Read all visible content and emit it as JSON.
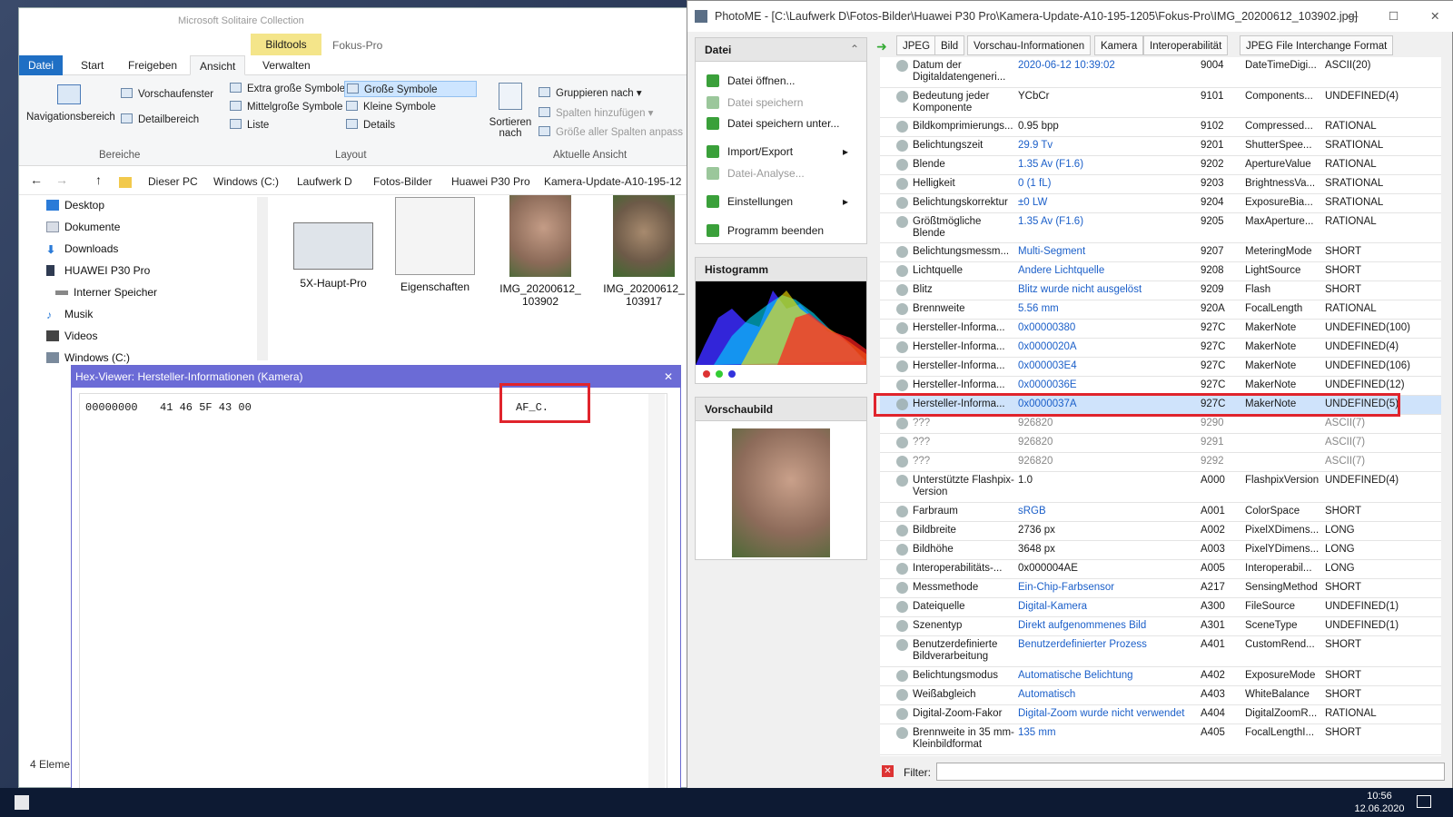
{
  "explorer": {
    "title_hint": "Microsoft Solitaire Collection",
    "ribbon_tabs": [
      "Datei",
      "Start",
      "Freigeben",
      "Ansicht",
      "Verwalten"
    ],
    "context_tab": "Bildtools",
    "context_title": "Fokus-Pro",
    "ribbon": {
      "nav_pane": "Navigationsbereich",
      "preview_pane": "Vorschaufenster",
      "details_pane": "Detailbereich",
      "group_panes": "Bereiche",
      "layout_items": [
        "Extra große Symbole",
        "Große Symbole",
        "Mittelgroße Symbole",
        "Kleine Symbole",
        "Liste",
        "Details"
      ],
      "group_layout": "Layout",
      "sort_label": "Sortieren nach",
      "group_by": "Gruppieren nach",
      "add_columns": "Spalten hinzufügen",
      "size_columns": "Größe aller Spalten anpass",
      "group_current": "Aktuelle Ansicht"
    },
    "breadcrumb": [
      "Dieser PC",
      "Windows (C:)",
      "Laufwerk D",
      "Fotos-Bilder",
      "Huawei P30 Pro",
      "Kamera-Update-A10-195-12"
    ],
    "nav_items": [
      "Desktop",
      "Dokumente",
      "Downloads",
      "HUAWEI P30 Pro",
      "Interner Speicher",
      "Musik",
      "Videos",
      "Windows (C:)"
    ],
    "thumbs": [
      "5X-Haupt-Pro",
      "Eigenschaften",
      "IMG_20200612_103902",
      "IMG_20200612_103917"
    ],
    "status": "4 Eleme"
  },
  "hex": {
    "title": "Hex-Viewer: Hersteller-Informationen (Kamera)",
    "offset": "00000000",
    "bytes": "41 46 5F 43 00",
    "ascii": "AF_C."
  },
  "photome": {
    "title": "PhotoME - [C:\\Laufwerk D\\Fotos-Bilder\\Huawei P30 Pro\\Kamera-Update-A10-195-1205\\Fokus-Pro\\IMG_20200612_103902.jpg]",
    "panel_file": "Datei",
    "menu": [
      {
        "label": "Datei öffnen...",
        "enabled": true
      },
      {
        "label": "Datei speichern",
        "enabled": false
      },
      {
        "label": "Datei speichern unter...",
        "enabled": true
      },
      {
        "label": "Import/Export",
        "enabled": true
      },
      {
        "label": "Datei-Analyse...",
        "enabled": false
      },
      {
        "label": "Einstellungen",
        "enabled": true
      },
      {
        "label": "Programm beenden",
        "enabled": true
      }
    ],
    "panel_hist": "Histogramm",
    "panel_preview": "Vorschaubild",
    "tabs": [
      "JPEG",
      "Bild",
      "Vorschau-Informationen",
      "Kamera",
      "Interoperabilität",
      "JPEG File Interchange Format"
    ],
    "rows": [
      {
        "name": "Datum der Digitaldatengeneri...",
        "value": "2020-06-12 10:39:02",
        "tag": "9004",
        "key": "DateTimeDigi...",
        "type": "ASCII(20)",
        "h": 34
      },
      {
        "name": "Bedeutung jeder Komponente",
        "value": "YCbCr",
        "tag": "9101",
        "key": "Components...",
        "type": "UNDEFINED(4)",
        "h": 33,
        "plain": true
      },
      {
        "name": "Bildkomprimierungs...",
        "value": "0.95 bpp",
        "tag": "9102",
        "key": "Compressed...",
        "type": "RATIONAL",
        "h": 21,
        "plain": true
      },
      {
        "name": "Belichtungszeit",
        "value": "29.9 Tv",
        "tag": "9201",
        "key": "ShutterSpee...",
        "type": "SRATIONAL",
        "h": 21
      },
      {
        "name": "Blende",
        "value": "1.35 Av (F1.6)",
        "tag": "9202",
        "key": "ApertureValue",
        "type": "RATIONAL",
        "h": 21
      },
      {
        "name": "Helligkeit",
        "value": "0 (1 fL)",
        "tag": "9203",
        "key": "BrightnessVa...",
        "type": "SRATIONAL",
        "h": 21
      },
      {
        "name": "Belichtungskorrektur",
        "value": "±0 LW",
        "tag": "9204",
        "key": "ExposureBia...",
        "type": "SRATIONAL",
        "h": 21
      },
      {
        "name": "Größtmögliche Blende",
        "value": "1.35 Av (F1.6)",
        "tag": "9205",
        "key": "MaxAperture...",
        "type": "RATIONAL",
        "h": 33
      },
      {
        "name": "Belichtungsmessm...",
        "value": "Multi-Segment",
        "tag": "9207",
        "key": "MeteringMode",
        "type": "SHORT",
        "h": 21
      },
      {
        "name": "Lichtquelle",
        "value": "Andere Lichtquelle",
        "tag": "9208",
        "key": "LightSource",
        "type": "SHORT",
        "h": 21
      },
      {
        "name": "Blitz",
        "value": "Blitz wurde nicht ausgelöst",
        "tag": "9209",
        "key": "Flash",
        "type": "SHORT",
        "h": 21
      },
      {
        "name": "Brennweite",
        "value": "5.56 mm",
        "tag": "920A",
        "key": "FocalLength",
        "type": "RATIONAL",
        "h": 21
      },
      {
        "name": "Hersteller-Informa...",
        "value": "0x00000380",
        "tag": "927C",
        "key": "MakerNote",
        "type": "UNDEFINED(100)",
        "h": 21
      },
      {
        "name": "Hersteller-Informa...",
        "value": "0x0000020A",
        "tag": "927C",
        "key": "MakerNote",
        "type": "UNDEFINED(4)",
        "h": 21
      },
      {
        "name": "Hersteller-Informa...",
        "value": "0x000003E4",
        "tag": "927C",
        "key": "MakerNote",
        "type": "UNDEFINED(106)",
        "h": 21
      },
      {
        "name": "Hersteller-Informa...",
        "value": "0x0000036E",
        "tag": "927C",
        "key": "MakerNote",
        "type": "UNDEFINED(12)",
        "h": 21
      },
      {
        "name": "Hersteller-Informa...",
        "value": "0x0000037A",
        "tag": "927C",
        "key": "MakerNote",
        "type": "UNDEFINED(5)",
        "h": 21,
        "selected": true
      },
      {
        "name": "???",
        "value": "926820",
        "tag": "9290",
        "key": "",
        "type": "ASCII(7)",
        "h": 21,
        "gray": true
      },
      {
        "name": "???",
        "value": "926820",
        "tag": "9291",
        "key": "",
        "type": "ASCII(7)",
        "h": 21,
        "gray": true
      },
      {
        "name": "???",
        "value": "926820",
        "tag": "9292",
        "key": "",
        "type": "ASCII(7)",
        "h": 21,
        "gray": true
      },
      {
        "name": "Unterstützte Flashpix-Version",
        "value": "1.0",
        "tag": "A000",
        "key": "FlashpixVersion",
        "type": "UNDEFINED(4)",
        "h": 34,
        "plain": true
      },
      {
        "name": "Farbraum",
        "value": "sRGB",
        "tag": "A001",
        "key": "ColorSpace",
        "type": "SHORT",
        "h": 21
      },
      {
        "name": "Bildbreite",
        "value": "2736 px",
        "tag": "A002",
        "key": "PixelXDimens...",
        "type": "LONG",
        "h": 21,
        "plain": true
      },
      {
        "name": "Bildhöhe",
        "value": "3648 px",
        "tag": "A003",
        "key": "PixelYDimens...",
        "type": "LONG",
        "h": 21,
        "plain": true
      },
      {
        "name": "Interoperabilitäts-...",
        "value": "0x000004AE",
        "tag": "A005",
        "key": "Interoperabil...",
        "type": "LONG",
        "h": 21,
        "plain": true
      },
      {
        "name": "Messmethode",
        "value": "Ein-Chip-Farbsensor",
        "tag": "A217",
        "key": "SensingMethod",
        "type": "SHORT",
        "h": 21
      },
      {
        "name": "Dateiquelle",
        "value": "Digital-Kamera",
        "tag": "A300",
        "key": "FileSource",
        "type": "UNDEFINED(1)",
        "h": 21
      },
      {
        "name": "Szenentyp",
        "value": "Direkt aufgenommenes Bild",
        "tag": "A301",
        "key": "SceneType",
        "type": "UNDEFINED(1)",
        "h": 21
      },
      {
        "name": "Benutzerdefinierte Bildverarbeitung",
        "value": "Benutzerdefinierter Prozess",
        "tag": "A401",
        "key": "CustomRend...",
        "type": "SHORT",
        "h": 34
      },
      {
        "name": "Belichtungsmodus",
        "value": "Automatische Belichtung",
        "tag": "A402",
        "key": "ExposureMode",
        "type": "SHORT",
        "h": 21
      },
      {
        "name": "Weißabgleich",
        "value": "Automatisch",
        "tag": "A403",
        "key": "WhiteBalance",
        "type": "SHORT",
        "h": 21
      },
      {
        "name": "Digital-Zoom-Fakor",
        "value": "Digital-Zoom wurde nicht verwendet",
        "tag": "A404",
        "key": "DigitalZoomR...",
        "type": "RATIONAL",
        "h": 21
      },
      {
        "name": "Brennweite in 35 mm-Kleinbildformat",
        "value": "135 mm",
        "tag": "A405",
        "key": "FocalLengthI...",
        "type": "SHORT",
        "h": 34
      }
    ],
    "filter_label": "Filter:",
    "filter_value": ""
  },
  "taskbar": {
    "time": "10:56",
    "date": "12.06.2020"
  },
  "colors": {
    "selection_border": "#e0242c",
    "accent": "#1f6fc4",
    "link": "#1b5fc9"
  }
}
